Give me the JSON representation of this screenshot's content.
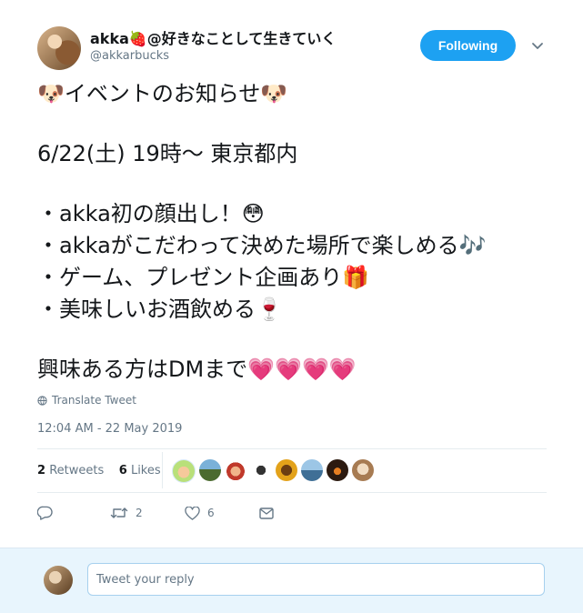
{
  "user": {
    "name": "akka",
    "name_emoji": "🍓",
    "name_suffix": "@好きなことして生きていく",
    "handle": "@akkarbucks"
  },
  "follow_button": {
    "label": "Following",
    "color": "#1da1f2"
  },
  "tweet": {
    "lines": [
      "🐶イベントのお知らせ🐶",
      "",
      "6/22(土) 19時〜 東京都内",
      "",
      "・akka初の顔出し！😳",
      "・akkaがこだわって決めた場所で楽しめる🎶",
      "・ゲーム、プレゼント企画あり🎁",
      "・美味しいお酒飲める🍷",
      "",
      "興味ある方はDMまで💗💗💗💗"
    ]
  },
  "translate_label": "Translate Tweet",
  "timestamp": "12:04 AM - 22 May 2019",
  "stats": {
    "retweets_count": "2",
    "retweets_label": "Retweets",
    "likes_count": "6",
    "likes_label": "Likes"
  },
  "actions": {
    "retweet_count": "2",
    "like_count": "6"
  },
  "reply": {
    "placeholder": "Tweet your reply"
  },
  "colors": {
    "accent": "#1da1f2",
    "muted": "#657786",
    "reply_bg": "#e8f5fd"
  }
}
